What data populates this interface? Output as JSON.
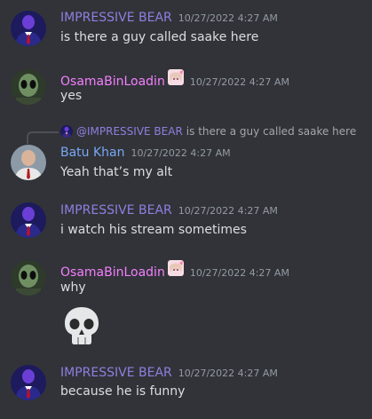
{
  "messages": [
    {
      "author": "IMPRESSIVE BEAR",
      "timestamp": "10/27/2022 4:27 AM",
      "text": "is there a guy called saake here"
    },
    {
      "author": "OsamaBinLoadin",
      "timestamp": "10/27/2022 4:27 AM",
      "text": "yes"
    },
    {
      "reply_to": {
        "mention": "@IMPRESSIVE BEAR",
        "text": "is there a guy called saake here"
      },
      "author": "Batu Khan",
      "timestamp": "10/27/2022 4:27 AM",
      "text": "Yeah that’s my alt"
    },
    {
      "author": "IMPRESSIVE BEAR",
      "timestamp": "10/27/2022 4:27 AM",
      "text": "i watch his stream sometimes"
    },
    {
      "author": "OsamaBinLoadin",
      "timestamp": "10/27/2022 4:27 AM",
      "text": "why",
      "emoji": "skull-emoji"
    },
    {
      "author": "IMPRESSIVE BEAR",
      "timestamp": "10/27/2022 4:27 AM",
      "text": "because he is funny"
    }
  ],
  "colors": {
    "background": "#313338",
    "impressive_bear": "#8e7fe0",
    "osama": "#f47fff",
    "batu": "#7aa7f5",
    "timestamp": "#949ba4",
    "text": "#dbdee1"
  }
}
